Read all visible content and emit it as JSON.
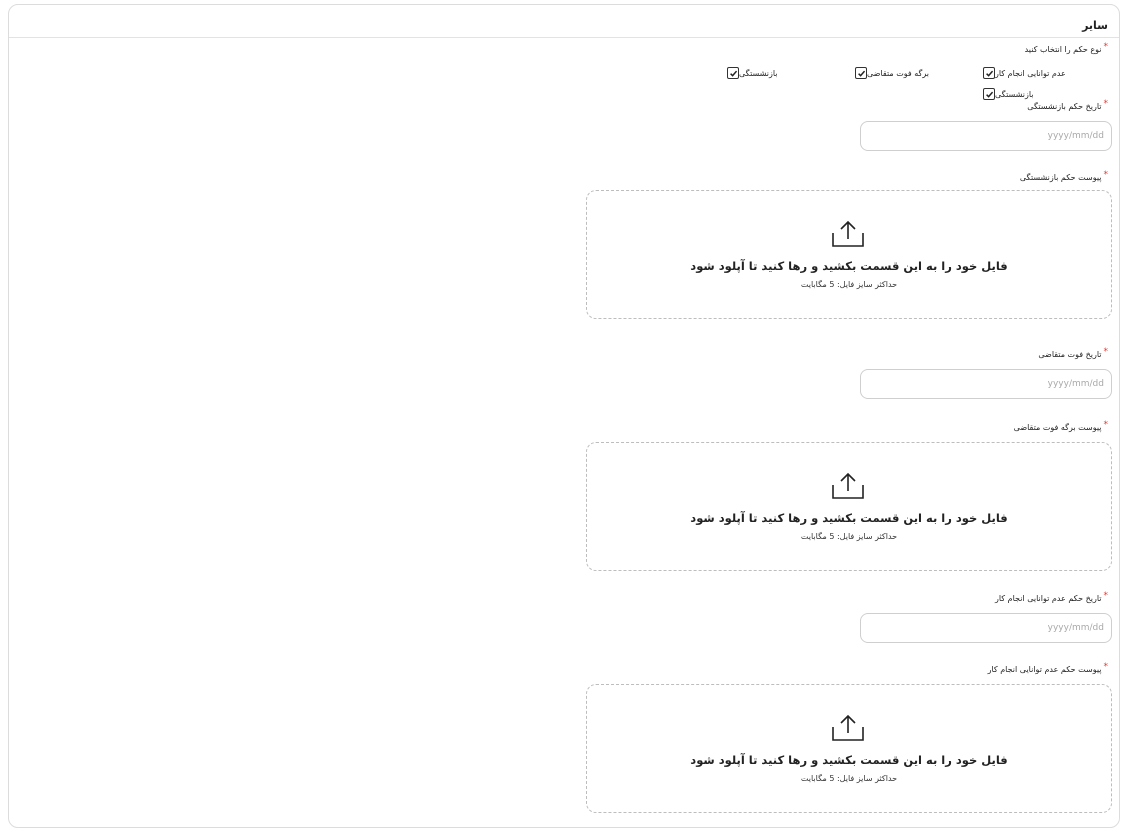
{
  "section": {
    "title": "سایر"
  },
  "ruling_type": {
    "label": "نوع حکم را انتخاب کنید",
    "options": [
      {
        "label": "عدم توانایی انجام کار",
        "checked": true
      },
      {
        "label": "برگه فوت متقاضی",
        "checked": true
      },
      {
        "label": "بازنشستگی",
        "checked": true
      },
      {
        "label": "بازنشستگی",
        "checked": true
      }
    ]
  },
  "retirement_date": {
    "label": "تاریخ حکم بازنشستگی",
    "placeholder": "yyyy/mm/dd"
  },
  "retirement_attachment": {
    "label": "پیوست حکم بازنشستگی",
    "drop_text": "فایل خود را به این قسمت بکشید و رها کنید تا آپلود شود",
    "max_size": "حداکثر سایز فایل: 5 مگابایت"
  },
  "death_date": {
    "label": "تاریخ فوت متقاضی",
    "placeholder": "yyyy/mm/dd"
  },
  "death_attachment": {
    "label": "پیوست برگه فوت متقاضی",
    "drop_text": "فایل خود را به این قسمت بکشید و رها کنید تا آپلود شود",
    "max_size": "حداکثر سایز فایل: 5 مگابایت"
  },
  "disability_date": {
    "label": "تاریخ حکم عدم توانایی انجام کار",
    "placeholder": "yyyy/mm/dd"
  },
  "disability_attachment": {
    "label": "پیوست حکم عدم توانایی انجام کار",
    "drop_text": "فایل خود را به این قسمت بکشید و رها کنید تا آپلود شود",
    "max_size": "حداکثر سایز فایل: 5 مگابایت"
  },
  "required_mark": "*",
  "colors": {
    "required": "#e53935",
    "border": "#cfcfcf",
    "dashed_border": "#bdbdbd"
  }
}
